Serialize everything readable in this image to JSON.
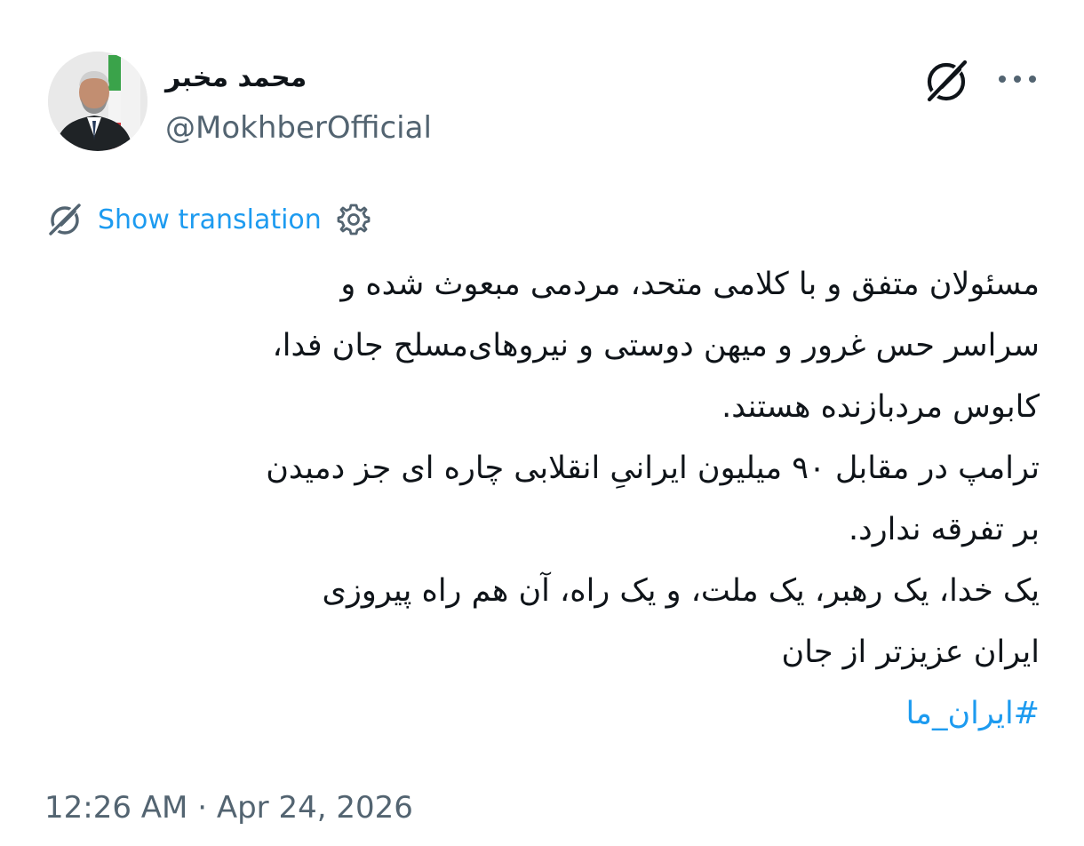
{
  "header": {
    "display_name": "محمد مخبر",
    "handle": "@MokhberOfficial"
  },
  "translation": {
    "link_label": "Show translation"
  },
  "tweet": {
    "lines": [
      "مسئولان متفق و با کلامی متحد، مردمی مبعوث شده و",
      "سراسر حس غرور و میهن دوستی و نیروهای‌مسلح جان فدا،",
      "کابوس مردبازنده هستند.",
      "ترامپ در مقابل ۹۰ میلیون ایرانیِ انقلابی چاره ای جز دمیدن",
      "بر تفرقه ندارد.",
      "یک خدا، یک رهبر، یک ملت، و یک راه، آن هم راه پیروزی",
      "ایران عزیزتر از جان"
    ],
    "hashtag": "#ایران_ما"
  },
  "meta": {
    "time": "12:26 AM",
    "separator": "·",
    "date": "Apr 24, 2026"
  },
  "icons": {
    "grok": "grok-icon",
    "more": "more-icon",
    "translate": "translate-icon",
    "settings": "gear-icon"
  },
  "colors": {
    "link_blue": "#1d9bf0",
    "secondary_text": "#536471",
    "primary_text": "#0f1419"
  }
}
